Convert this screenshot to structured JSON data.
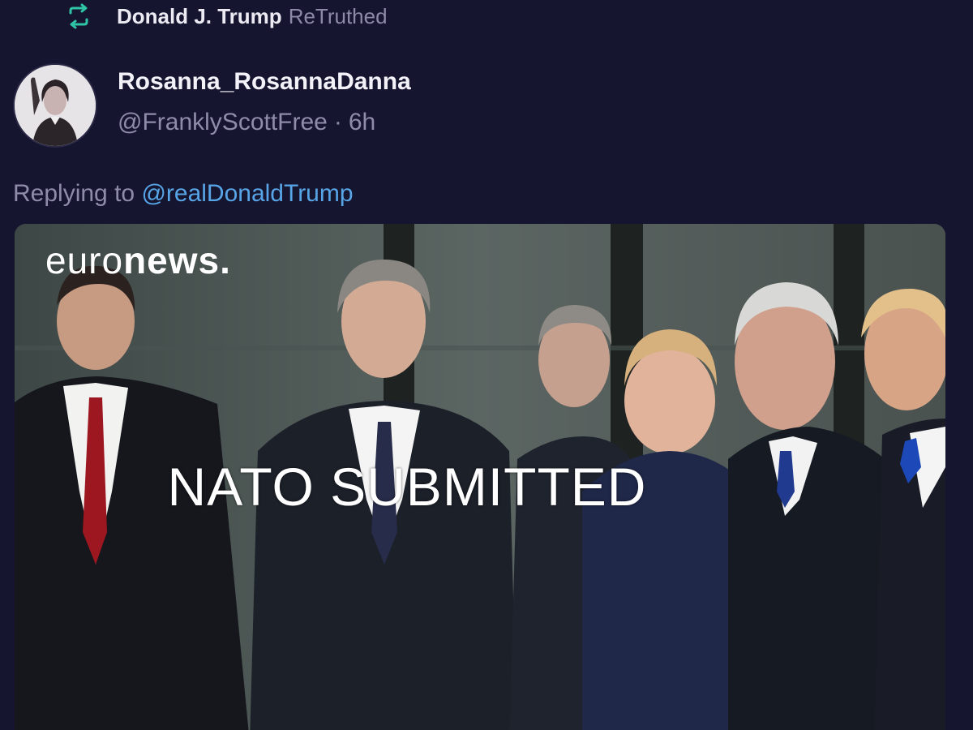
{
  "retruth": {
    "icon": "retruth-icon",
    "name": "Donald J. Trump",
    "action": "ReTruthed",
    "icon_color": "#2ec4a5"
  },
  "author": {
    "display_name": "Rosanna_RosannaDanna",
    "handle": "@FranklyScottFree",
    "separator": "·",
    "time": "6h"
  },
  "reply": {
    "prefix": "Replying to",
    "mention": "@realDonaldTrump"
  },
  "media": {
    "logo_light": "euro",
    "logo_bold": "news.",
    "caption": "NATO SUBMITTED"
  },
  "colors": {
    "background": "#16152f",
    "muted_text": "#8e8ca8",
    "link": "#57a5e6"
  }
}
